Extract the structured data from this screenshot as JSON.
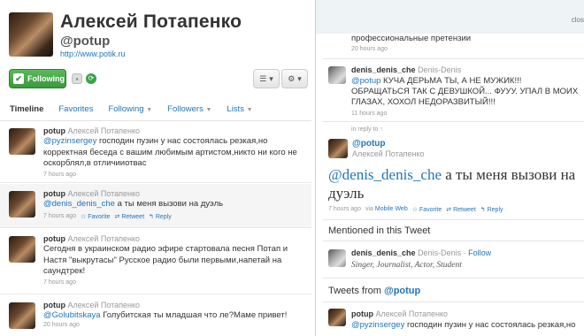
{
  "profile": {
    "name": "Алексей Потапенко",
    "screen_name": "@potup",
    "url": "http://www.potik.ru",
    "following_label": "Following"
  },
  "tabs": [
    {
      "label": "Timeline"
    },
    {
      "label": "Favorites"
    },
    {
      "label": "Following"
    },
    {
      "label": "Followers"
    },
    {
      "label": "Lists"
    }
  ],
  "tweets": [
    {
      "user": "potup",
      "full_name": "Алексей Потапенко",
      "mention": "@pyzinsergey",
      "text_rest": " господин пузин у нас состоялась резкая,но корректная беседа с вашим любимым артистом,никто ни кого не оскорблял,в отличииотвас",
      "time": "7 hours ago"
    },
    {
      "user": "potup",
      "full_name": "Алексей Потапенко",
      "mention": "@denis_denis_che",
      "text_rest": " а ты меня вызови на дуэль",
      "time": "7 hours ago",
      "favorite": "Favorite",
      "retweet": "Retweet",
      "reply": "Reply"
    },
    {
      "user": "potup",
      "full_name": "Алексей Потапенко",
      "text": "Сегодня в украинском радио эфире стартовала песня Потап и Настя \"выкрутасы\" Русское радио были первыми,напетай на саундтрек!",
      "time": "7 hours ago"
    },
    {
      "user": "potup",
      "full_name": "Алексей Потапенко",
      "mention": "@Golubitskaya",
      "text_rest": " Голубитская ты младшая что ле?Маме привет!",
      "time": "20 hours ago"
    }
  ],
  "detail": {
    "close_label": "clos",
    "prev_text": "профессиональные претензии",
    "prev_time": "20 hours ago",
    "reply_user": "denis_denis_che",
    "reply_full": "Denis-Denis",
    "reply_mention": "@potup",
    "reply_text_rest": " КУЧА ДЕРЬМА ТЫ, А НЕ МУЖИК!!! ОБРАЩАТЬСЯ ТАК С ДЕВУШКОЙ... ФУУУ. УПАЛ В МОИХ ГЛАЗАХ, ХОХОЛ НЕДОРАЗВИТЫЙ!!!",
    "reply_time": "11 hours ago",
    "in_reply_to": "in reply to ↑",
    "main_user": "@potup",
    "main_full": "Алексей Потапенко",
    "main_mention": "@denis_denis_che",
    "main_text_rest": " а ты меня вызови на дуэль",
    "main_time": "7 hours ago",
    "main_via_prefix": "via",
    "main_via": "Mobile Web",
    "favorite": "Favorite",
    "retweet": "Retweet",
    "reply": "Reply",
    "mentioned_title": "Mentioned in this Tweet",
    "mentioned_user": "denis_denis_che",
    "mentioned_full": "Denis-Denis",
    "mentioned_follow": "Follow",
    "mentioned_bio": "Singer, Journalist, Actor, Student",
    "tweets_from_prefix": "Tweets from",
    "tweets_from_user": "@potup",
    "bottom_user": "potup",
    "bottom_full": "Алексей Потапенко",
    "bottom_mention": "@pyzinsergey",
    "bottom_text_rest": " господин пузин у нас состоялась резкая,но"
  }
}
